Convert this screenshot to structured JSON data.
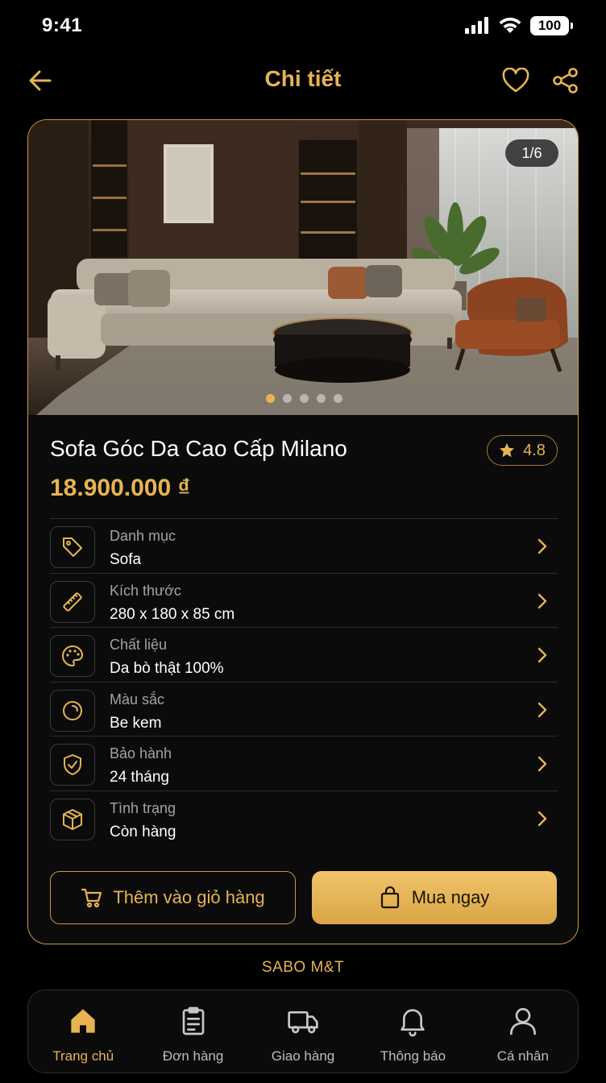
{
  "status_bar": {
    "time": "9:41",
    "battery": "100"
  },
  "header": {
    "title": "Chi tiết",
    "back_icon": "arrow-left-icon",
    "favorite_icon": "heart-icon",
    "share_icon": "share-icon"
  },
  "product": {
    "image_counter": "1/6",
    "image_count": 5,
    "active_image_index": 0,
    "name": "Sofa Góc Da Cao Cấp Milano",
    "rating": "4.8",
    "price": "18.900.000 ₫"
  },
  "specs": [
    {
      "icon": "tag-icon",
      "label": "Danh mục",
      "value": "Sofa"
    },
    {
      "icon": "ruler-icon",
      "label": "Kích thước",
      "value": "280 x 180 x 85 cm"
    },
    {
      "icon": "palette-icon",
      "label": "Chất liệu",
      "value": "Da bò thật 100%"
    },
    {
      "icon": "color-circle-icon",
      "label": "Màu sắc",
      "value": "Be kem"
    },
    {
      "icon": "shield-check-icon",
      "label": "Bảo hành",
      "value": "24 tháng"
    },
    {
      "icon": "box-icon",
      "label": "Tình trạng",
      "value": "Còn hàng"
    }
  ],
  "actions": {
    "add_to_cart": "Thêm vào giỏ hàng",
    "buy_now": "Mua ngay"
  },
  "brand": "SABO M&T",
  "nav": [
    {
      "icon": "home-icon",
      "label": "Trang chủ",
      "active": true
    },
    {
      "icon": "clipboard-icon",
      "label": "Đơn hàng",
      "active": false
    },
    {
      "icon": "truck-icon",
      "label": "Giao hàng",
      "active": false
    },
    {
      "icon": "bell-icon",
      "label": "Thông báo",
      "active": false
    },
    {
      "icon": "user-icon",
      "label": "Cá nhân",
      "active": false
    }
  ],
  "colors": {
    "accent": "#e7b451",
    "background": "#000000",
    "card": "#0b0b0b",
    "border": "#c9993f"
  }
}
